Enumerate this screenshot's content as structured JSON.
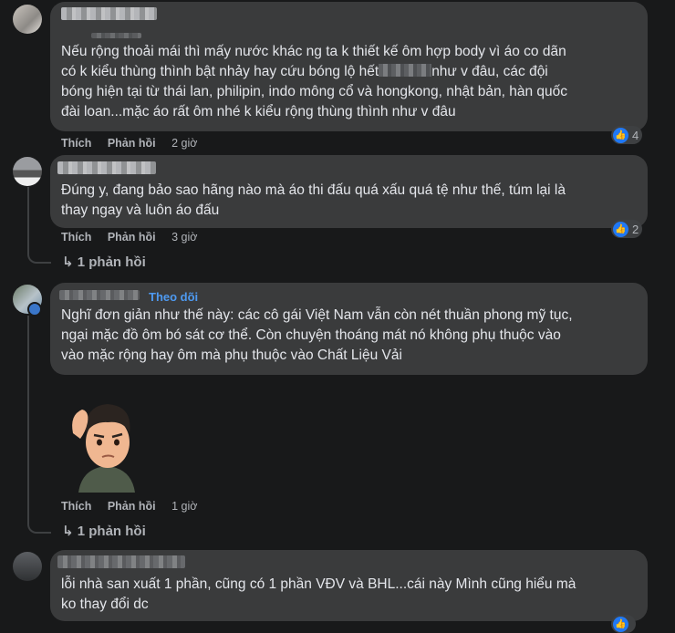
{
  "comments": [
    {
      "text_line1": "Nếu rộng thoải mái thì mấy nước khác ng ta k thiết kế ôm hợp body vì áo co dãn",
      "text_line2a": "có k kiểu thùng thình bật nhảy hay cứu bóng lộ hết",
      "text_line2b": "như v đâu, các đội",
      "text_line3": "bóng hiện tại từ thái lan, philipin, indo mông cổ và hongkong, nhật bản, hàn quốc",
      "text_line4": "đài loan...mặc áo rất ôm nhé k kiểu rộng thùng thình như v đâu",
      "like": "Thích",
      "reply": "Phản hồi",
      "time": "2 giờ",
      "reactions": "4"
    },
    {
      "text_line1": "Đúng y, đang bảo sao hãng nào mà áo thi đấu quá xấu quá tệ như thế, túm lại là",
      "text_line2": "thay ngay và luôn áo đấu",
      "like": "Thích",
      "reply": "Phản hồi",
      "time": "3 giờ",
      "reactions": "2",
      "replies": "1 phản hồi"
    },
    {
      "follow": "Theo dõi",
      "text_line1": "Nghĩ đơn giản như thế này: các cô gái Việt Nam vẫn còn nét thuần phong mỹ tục,",
      "text_line2": "ngại mặc đồ ôm bó sát cơ thể. Còn chuyện thoáng mát nó không phụ thuộc vào",
      "text_line3": "vào mặc rộng hay ôm mà phụ thuộc vào Chất Liệu Vải",
      "like": "Thích",
      "reply": "Phản hồi",
      "time": "1 giờ",
      "replies": "1 phản hồi"
    },
    {
      "text_line1": "lỗi nhà san xuất 1 phần, cũng có 1 phần VĐV và BHL...cái này Mình cũng hiểu mà",
      "text_line2": "ko thay đổi dc"
    }
  ],
  "icons": {
    "like": "thumbs-up-icon",
    "reply_arrow": "reply-arrow-icon"
  }
}
